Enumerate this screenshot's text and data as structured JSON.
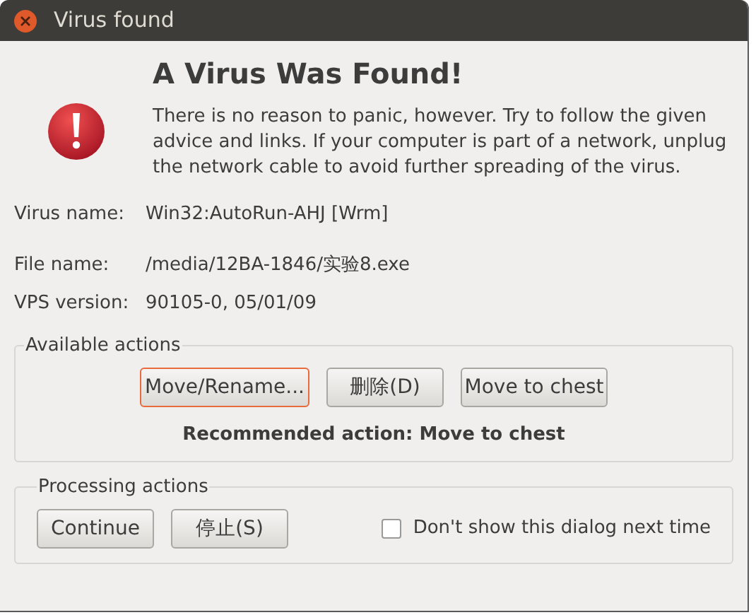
{
  "window": {
    "title": "Virus found"
  },
  "heading": "A Virus Was Found!",
  "message": "There is no reason to panic, however. Try to follow the given advice and links. If your computer is part of a network, unplug the network cable to avoid further spreading of the virus.",
  "details": [
    {
      "label": "Virus name:",
      "value": "Win32:AutoRun-AHJ [Wrm]"
    },
    {
      "label": "File name:",
      "value": "/media/12BA-1846/实验8.exe"
    },
    {
      "label": "VPS version:",
      "value": "90105-0, 05/01/09"
    }
  ],
  "available_actions": {
    "title": "Available actions",
    "buttons": [
      {
        "label": "Move/Rename...",
        "focused": true
      },
      {
        "label": "删除(D)",
        "focused": false
      },
      {
        "label": "Move to chest",
        "focused": false
      }
    ],
    "recommendation": "Recommended action: Move to chest"
  },
  "processing_actions": {
    "title": "Processing actions",
    "buttons": [
      {
        "label": "Continue",
        "focused": false
      },
      {
        "label": "停止(S)",
        "focused": false
      }
    ],
    "checkbox": {
      "label": "Don't show this dialog next time",
      "checked": false
    }
  }
}
